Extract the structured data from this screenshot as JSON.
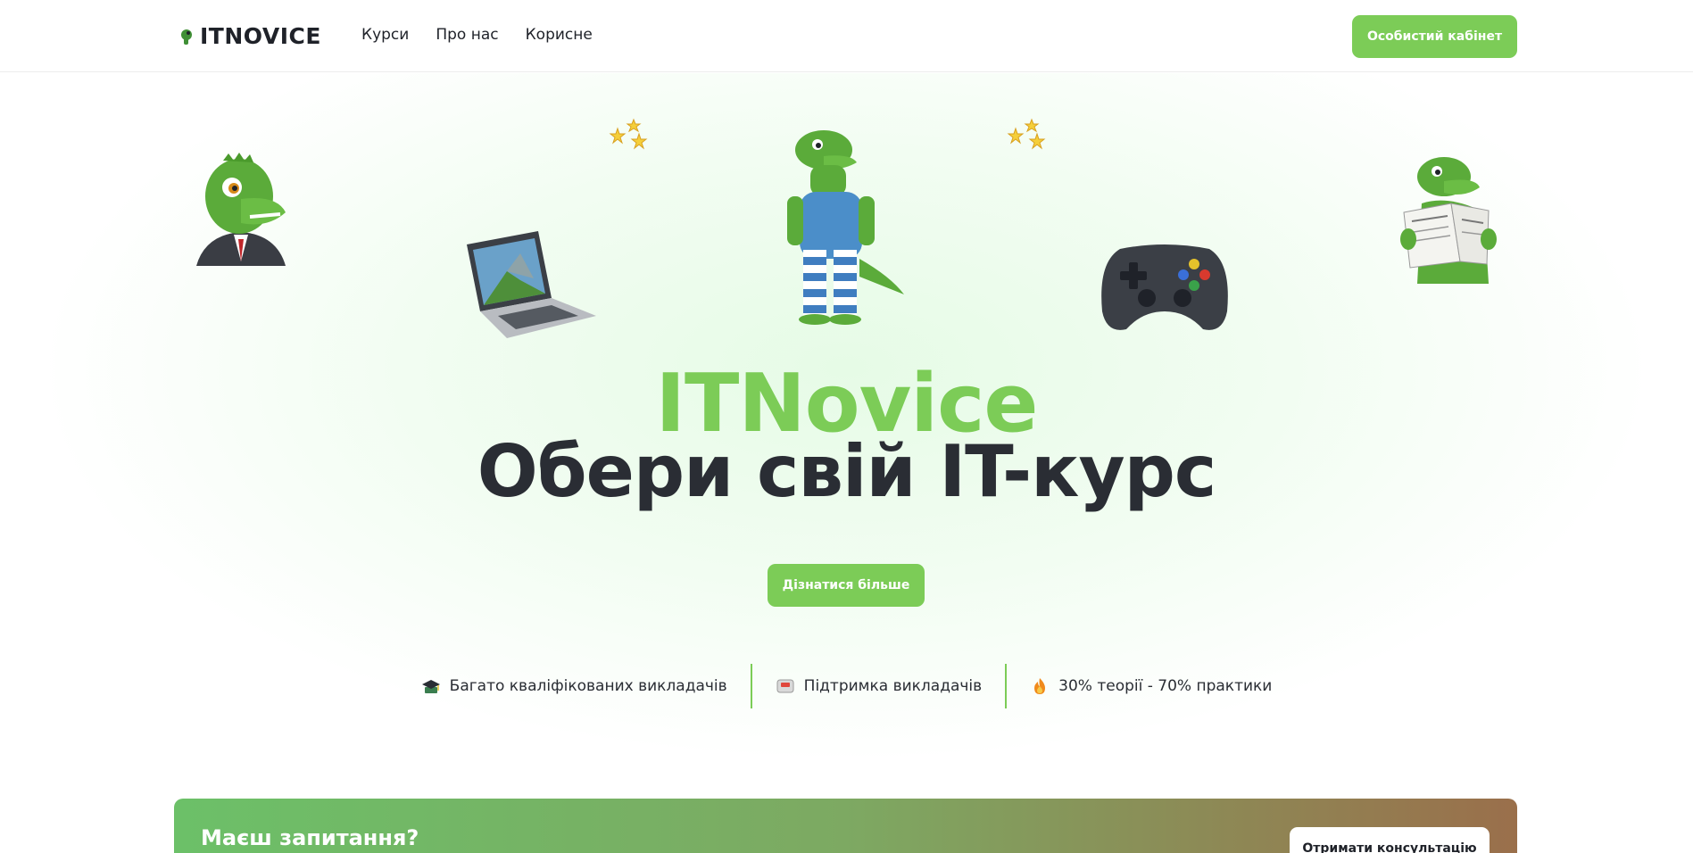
{
  "header": {
    "logo_text": "ITNOVICE",
    "nav": [
      {
        "label": "Курси"
      },
      {
        "label": "Про нас"
      },
      {
        "label": "Корисне"
      }
    ],
    "cabinet_button": "Особистий кабінет"
  },
  "hero": {
    "brand": "ITNovice",
    "title": "Обери свій IT-курс",
    "cta_button": "Дізнатися більше",
    "features": [
      {
        "icon": "graduation-cap-icon",
        "label": "Багато кваліфікованих викладачів"
      },
      {
        "icon": "message-box-icon",
        "label": "Підтримка викладачів"
      },
      {
        "icon": "fire-icon",
        "label": "30% теорії - 70% практики"
      }
    ]
  },
  "banner": {
    "text": "Маєш запитання?",
    "button": "Отримати консультацію"
  },
  "colors": {
    "accent": "#7ccc57",
    "dark": "#2a2d34"
  }
}
